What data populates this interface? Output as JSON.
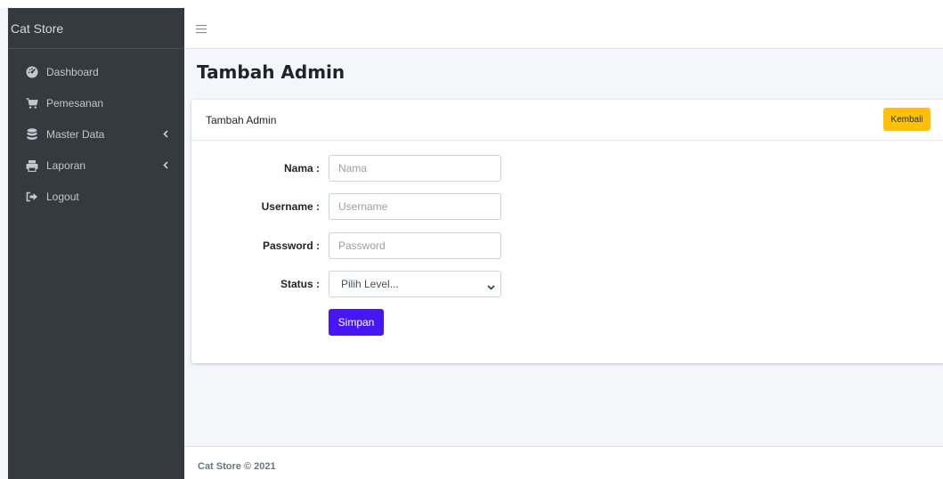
{
  "brand": {
    "name": "Cat Store"
  },
  "sidebar": {
    "items": [
      {
        "label": "Dashboard",
        "icon": "tachometer-icon"
      },
      {
        "label": "Pemesanan",
        "icon": "shopping-cart-icon"
      },
      {
        "label": "Master Data",
        "icon": "database-icon",
        "has_submenu": true
      },
      {
        "label": "Laporan",
        "icon": "print-icon",
        "has_submenu": true
      },
      {
        "label": "Logout",
        "icon": "sign-out-icon"
      }
    ]
  },
  "topbar": {
    "menu_icon": "hamburger-icon"
  },
  "page": {
    "title": "Tambah Admin"
  },
  "card": {
    "title": "Tambah Admin",
    "back_label": "Kembali"
  },
  "form": {
    "nama": {
      "label": "Nama :",
      "placeholder": "Nama",
      "value": ""
    },
    "username": {
      "label": "Username :",
      "placeholder": "Username",
      "value": ""
    },
    "password": {
      "label": "Password :",
      "placeholder": "Password",
      "value": ""
    },
    "status": {
      "label": "Status :",
      "selected": "Pilih Level..."
    },
    "submit_label": "Simpan"
  },
  "footer": {
    "text": "Cat Store © 2021"
  },
  "colors": {
    "sidebar_bg": "#343a40",
    "content_bg": "#f4f6f9",
    "back_button": "#ffc107",
    "save_button": "#4716f7"
  }
}
